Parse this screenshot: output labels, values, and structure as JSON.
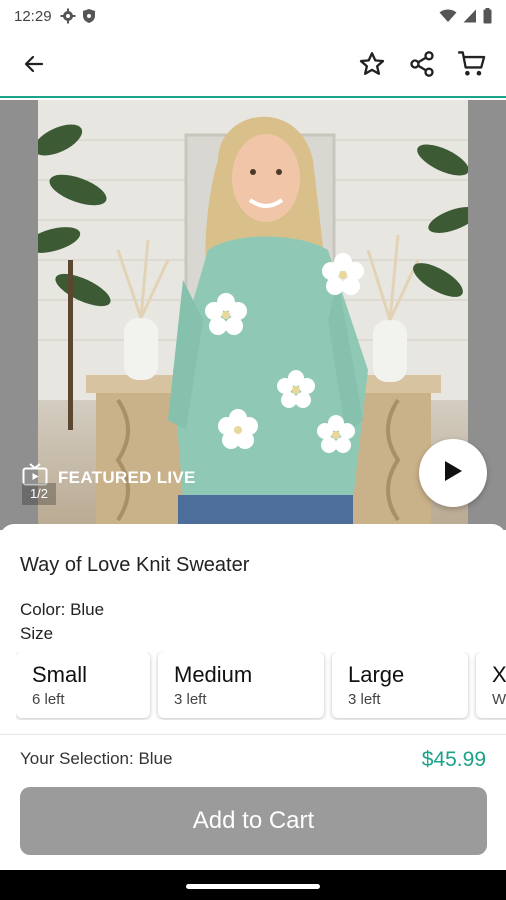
{
  "status_bar": {
    "time": "12:29",
    "icons": [
      "gear-icon",
      "shield-icon",
      "wifi-icon",
      "signal-icon",
      "battery-icon"
    ]
  },
  "app_bar": {
    "icons": [
      "back-arrow-icon",
      "star-outline-icon",
      "share-icon",
      "cart-icon"
    ]
  },
  "media": {
    "featured_label": "FEATURED LIVE",
    "counter": "1/2",
    "icons": [
      "live-tv-icon",
      "play-icon"
    ]
  },
  "product": {
    "title": "Way of Love Knit Sweater",
    "color_line": "Color: Blue",
    "size_label": "Size",
    "sizes": [
      {
        "name": "Small",
        "stock": "6 left"
      },
      {
        "name": "Medium",
        "stock": "3 left"
      },
      {
        "name": "Large",
        "stock": "3 left"
      },
      {
        "name": "X",
        "stock": "W"
      }
    ],
    "selection": "Your Selection: Blue",
    "price": "$45.99",
    "add_to_cart": "Add to Cart"
  },
  "colors": {
    "accent": "#1aa38a",
    "button_disabled": "#9b9b9b"
  }
}
